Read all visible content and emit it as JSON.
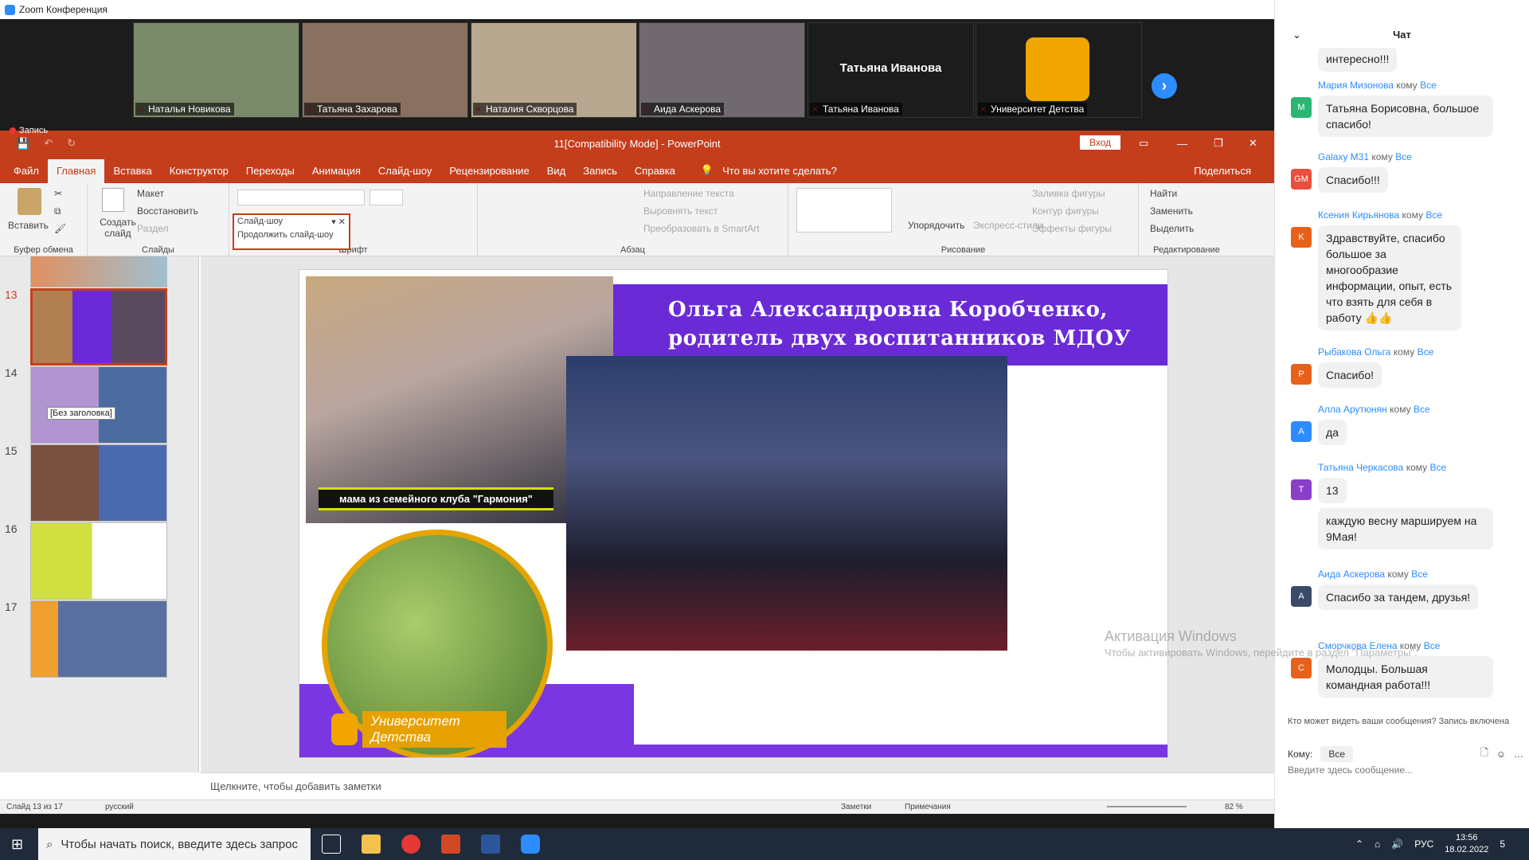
{
  "zoom": {
    "window_title": "Zoom Конференция",
    "recording_label": "Запись",
    "participants": [
      {
        "name": "Наталья Новикова",
        "bg": "#7a8a6a"
      },
      {
        "name": "Татьяна Захарова",
        "bg": "#8a7060"
      },
      {
        "name": "Наталия Скворцова",
        "bg": "#b8a890"
      },
      {
        "name": "Аида Аскерова",
        "bg": "#706a70"
      },
      {
        "name": "Татьяна Иванова",
        "bg": "#1c1c1c",
        "center_text": "Татьяна Иванова"
      },
      {
        "name": "Университет Детства",
        "bg": "#1c1c1c"
      }
    ]
  },
  "ppt": {
    "title": "11[Compatibility Mode] - PowerPoint",
    "login_label": "Вход",
    "tabs": [
      "Файл",
      "Главная",
      "Вставка",
      "Конструктор",
      "Переходы",
      "Анимация",
      "Слайд-шоу",
      "Рецензирование",
      "Вид",
      "Запись",
      "Справка"
    ],
    "active_tab": "Главная",
    "tell_me": "Что вы хотите сделать?",
    "share": "Поделиться",
    "ribbon": {
      "paste": "Вставить",
      "clipboard": "Буфер обмена",
      "new_slide": "Создать слайд",
      "layout": "Макет",
      "reset": "Восстановить",
      "section": "Раздел",
      "slides": "Слайды",
      "font": "Шрифт",
      "paragraph": "Абзац",
      "text_direction": "Направление текста",
      "align_text": "Выровнять текст",
      "smartart": "Преобразовать в SmartArt",
      "arrange": "Упорядочить",
      "quick_styles": "Экспресс-стили",
      "shape_fill": "Заливка фигуры",
      "shape_outline": "Контур фигуры",
      "shape_effects": "Эффекты фигуры",
      "drawing": "Рисование",
      "find": "Найти",
      "replace": "Заменить",
      "select": "Выделить",
      "editing": "Редактирование",
      "dropdown_title": "Слайд-шоу",
      "dropdown_item": "Продолжить слайд-шоу"
    },
    "thumbnails": [
      {
        "num": "",
        "top": 0
      },
      {
        "num": "13",
        "selected": true
      },
      {
        "num": "14",
        "tooltip": "[Без заголовка]"
      },
      {
        "num": "15"
      },
      {
        "num": "16"
      },
      {
        "num": "17"
      }
    ],
    "slide": {
      "header_line1": "Ольга Александровна Коробченко,",
      "header_line2": "родитель двух воспитанников МДОУ",
      "caption": "мама из семейного клуба \"Гармония\"",
      "logo_text": "Университет Детства"
    },
    "notes_placeholder": "Щелкните, чтобы добавить заметки",
    "status": {
      "slide_of": "Слайд 13 из 17",
      "language": "русский",
      "notes": "Заметки",
      "comments": "Примечания",
      "zoom": "82 %"
    },
    "activation": {
      "line1": "Активация Windows",
      "line2": "Чтобы активировать Windows, перейдите в раздел \"Параметры\"."
    }
  },
  "chat": {
    "title": "Чат",
    "messages": [
      {
        "sender": "Мария Мизонова",
        "to": "кому",
        "target": "Все",
        "avatar": "M",
        "color": "#2bb673",
        "text": "Татьяна Борисовна, большое спасибо!"
      },
      {
        "sender": "Galaxy M31",
        "to": "кому",
        "target": "Все",
        "avatar": "GM",
        "color": "#e84f3d",
        "text": "Спасибо!!!"
      },
      {
        "sender": "Ксения Кирьянова",
        "to": "кому",
        "target": "Все",
        "avatar": "K",
        "color": "#e8611a",
        "text": "Здравствуйте, спасибо большое за многообразие информации, опыт, есть что взять для себя в работу 👍👍"
      },
      {
        "sender": "Рыбакова Ольга",
        "to": "кому",
        "target": "Все",
        "avatar": "P",
        "color": "#e8611a",
        "text": "Спасибо!"
      },
      {
        "sender": "Алла Арутюнян",
        "to": "кому",
        "target": "Все",
        "avatar": "A",
        "color": "#2d8cff",
        "text": "да"
      },
      {
        "sender": "Татьяна Черкасова",
        "to": "кому",
        "target": "Все",
        "avatar": "T",
        "color": "#8b3fc8",
        "text": "13"
      },
      {
        "sender": "",
        "avatar": "",
        "color": "",
        "text": "каждую весну маршируем на 9Мая!"
      },
      {
        "sender": "Аида Аскерова",
        "to": "кому",
        "target": "Все",
        "avatar": "A",
        "color": "#3b4a66",
        "text": "Спасибо за тандем, друзья!"
      },
      {
        "sender": "Сморчкова Елена",
        "to": "кому",
        "target": "Все",
        "avatar": "C",
        "color": "#e8611a",
        "text": "Молодцы. Большая командная работа!!!"
      }
    ],
    "top_partial": "интересно!!!",
    "notice": "Кто может видеть ваши сообщения? Запись включена",
    "to_label": "Кому:",
    "to_value": "Все",
    "input_placeholder": "Введите здесь сообщение..."
  },
  "taskbar": {
    "search_placeholder": "Чтобы начать поиск, введите здесь запрос",
    "lang": "РУС",
    "time": "13:56",
    "date": "18.02.2022",
    "notif_count": "5"
  }
}
